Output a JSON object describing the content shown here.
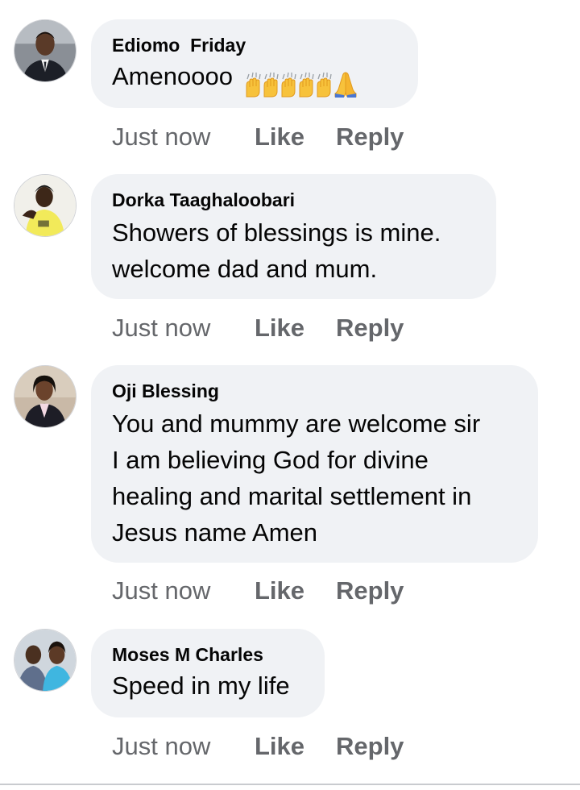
{
  "comments": [
    {
      "author": "Ediomo  Friday",
      "lines": [
        "Amenoooo"
      ],
      "emoji": [
        "raising-hands-icon",
        "raising-hands-icon",
        "raising-hands-icon",
        "raising-hands-icon",
        "raising-hands-icon",
        "folded-hands-icon"
      ],
      "time": "Just now",
      "like": "Like",
      "reply": "Reply"
    },
    {
      "author": "Dorka Taaghaloobari",
      "lines": [
        "Showers of blessings is mine.",
        "welcome dad and mum."
      ],
      "time": "Just now",
      "like": "Like",
      "reply": "Reply"
    },
    {
      "author": "Oji Blessing",
      "lines": [
        "You and mummy are welcome sir",
        "I am believing God for divine",
        "healing and marital settlement in",
        "Jesus name Amen"
      ],
      "time": "Just now",
      "like": "Like",
      "reply": "Reply"
    },
    {
      "author": "Moses M Charles",
      "lines": [
        "Speed in my life"
      ],
      "time": "Just now",
      "like": "Like",
      "reply": "Reply"
    }
  ],
  "colors": {
    "bubble": "#f0f2f5",
    "meta_text": "#65676b",
    "body_text": "#050505"
  }
}
